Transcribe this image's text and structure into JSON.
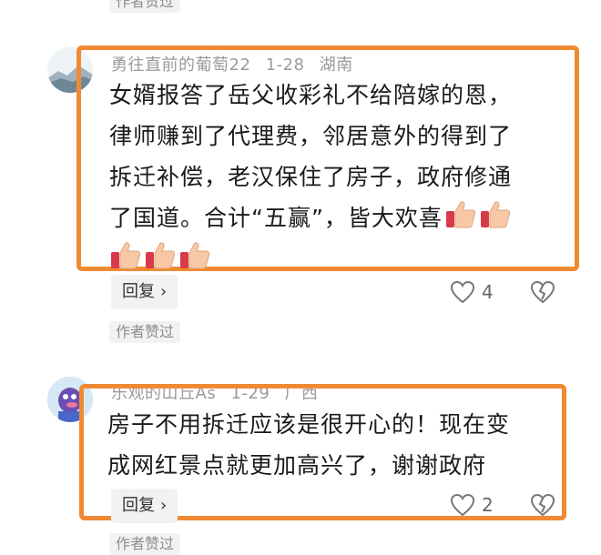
{
  "comments": [
    {
      "username": "勇往直前的葡萄22",
      "date": "1-28",
      "location": "湖南",
      "lines": [
        "女婿报答了岳父收彩礼不给陪嫁的恩，",
        "律师赚到了代理费，邻居意外的得到了",
        "拆迁补偿，老汉保住了房子，政府修通",
        "了国道。合计“五赢”，皆大欢喜"
      ],
      "emoji": "thumbs-up-icon",
      "emoji_count_line4": 2,
      "emoji_count_line5": 3,
      "reply_label": "回复",
      "like_count": "4",
      "author_liked": "作者赞过"
    },
    {
      "username": "乐观的山丘As",
      "date": "1-29",
      "location": "广西",
      "lines": [
        "房子不用拆迁应该是很开心的！现在变",
        "成网红景点就更加高兴了，谢谢政府"
      ],
      "reply_label": "回复",
      "like_count": "2",
      "author_liked": "作者赞过"
    }
  ],
  "top_author_liked": "作者赞过",
  "colors": {
    "highlight": "#f08a32",
    "text": "#1a1a1a",
    "meta": "#9a9a9a",
    "chip_bg": "#f2f2f2"
  }
}
